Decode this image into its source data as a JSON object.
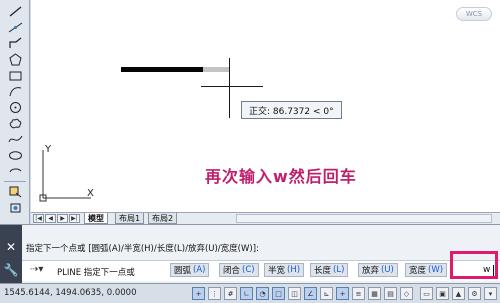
{
  "canvas": {
    "wcs_label": "WCS",
    "tooltip_text": "正交: 86.7372 < 0°",
    "ucs_y_label": "Y",
    "ucs_x_label": "X",
    "caption": "再次输入w然后回车",
    "caption_color": "#c01f6e"
  },
  "layout_tabs": {
    "nav_buttons": [
      "|◀",
      "◀",
      "▶",
      "▶|"
    ],
    "tabs": [
      "模型",
      "布局1",
      "布局2"
    ]
  },
  "command": {
    "history_line": "指定下一个点或 [圆弧(A)/半宽(H)/长度(L)/放弃(U)/宽度(W)]:",
    "prompt": "PLINE 指定下一点或",
    "options": [
      {
        "label": "圆弧",
        "key": "(A)"
      },
      {
        "label": "闭合",
        "key": "(C)"
      },
      {
        "label": "半宽",
        "key": "(H)"
      },
      {
        "label": "长度",
        "key": "(L)"
      },
      {
        "label": "放弃",
        "key": "(U)"
      },
      {
        "label": "宽度",
        "key": "(W)"
      }
    ],
    "typed_value": "w",
    "highlight_color": "#e01a6e"
  },
  "status": {
    "coordinates": "1545.6144, 1494.0635, 0.0000"
  },
  "icons": {
    "left_toolbar": [
      "line-icon",
      "construction-line-icon",
      "polyline-icon",
      "polygon-icon",
      "rectangle-icon",
      "arc-icon",
      "circle-icon",
      "revision-cloud-icon",
      "spline-icon",
      "ellipse-icon",
      "ellipse-arc-icon",
      "insert-block-icon",
      "make-block-icon",
      "point-icon",
      "hatch-icon"
    ]
  }
}
